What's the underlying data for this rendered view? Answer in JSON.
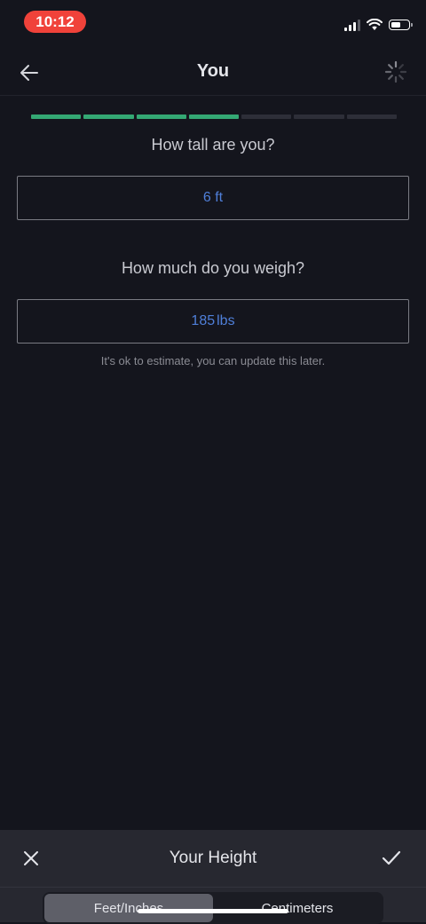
{
  "status_bar": {
    "time": "10:12",
    "icons": [
      "signal-icon",
      "wifi-icon",
      "battery-icon"
    ]
  },
  "header": {
    "title": "You",
    "back_icon": "arrow-left-icon",
    "loading_icon": "spinner-icon"
  },
  "progress": {
    "completed_steps": 4,
    "total_steps": 7,
    "active_color": "#34a874",
    "inactive_color": "#2d2e38"
  },
  "height": {
    "question": "How tall are you?",
    "value": "6 ft"
  },
  "weight": {
    "question": "How much do you weigh?",
    "value": "185",
    "unit": "lbs",
    "hint": "It's ok to estimate, you can update this later."
  },
  "sheet": {
    "title": "Your Height",
    "close_icon": "close-icon",
    "confirm_icon": "checkmark-icon",
    "options": [
      {
        "label": "Feet/Inches",
        "active": true
      },
      {
        "label": "Centimeters",
        "active": false
      }
    ]
  },
  "colors": {
    "background": "#14151d",
    "accent_blue": "#4f7fd9",
    "time_pill": "#f0423a"
  }
}
